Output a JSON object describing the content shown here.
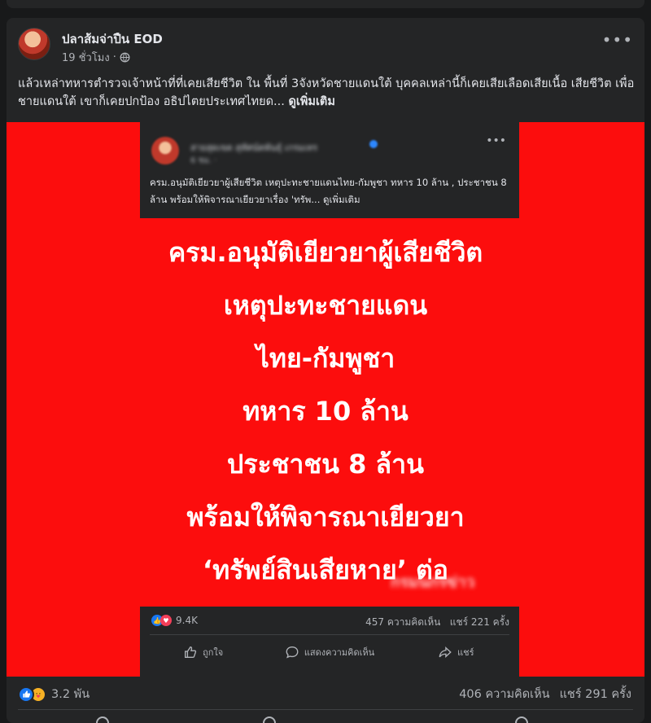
{
  "post": {
    "author": "ปลาส้มจ่าปืน EOD",
    "time": "19 ชั่วโมง",
    "separator": "·",
    "caption": "แล้วเหล่าทหารตำรวจเจ้าหน้าที่ที่เคยเสียชีวิต ใน พื้นที่ 3จังหวัดชายแดนใต้ บุคคลเหล่านี้ก็เคยเสียเลือดเสียเนื้อ เสียชีวิต เพื่อชายแดนใต้ เขาก็เคยปกป้อง อธิปไตยประเทศไทยด...",
    "see_more": "ดูเพิ่มเติม"
  },
  "inner_post": {
    "author": "สายสุดเขต สุทัศน์ตพันธุ์ เกรมเทร",
    "time": "6 ชม. ·",
    "caption": "ครม.อนุมัติเยียวยาผู้เสียชีวิต เหตุปะทะชายแดนไทย-กัมพูชา ทหาร 10 ล้าน , ประชาชน 8 ล้าน พร้อมให้พิจารณาเยียวยาเรื่อง 'ทรัพ...",
    "see_more": "ดูเพิ่มเติม",
    "reactions": "9.4K",
    "comments": "457 ความคิดเห็น",
    "shares": "แชร์ 221 ครั้ง",
    "like_label": "ถูกใจ",
    "comment_label": "แสดงความคิดเห็น",
    "share_label": "แชร์"
  },
  "headline": {
    "line1": "ครม.อนุมัติเยียวยาผู้เสียชีวิต",
    "line2": "เหตุปะทะชายแดน",
    "line3": "ไทย-กัมพูชา",
    "line4": "ทหาร 10 ล้าน",
    "line5": "ประชาชน 8 ล้าน",
    "line6": "พร้อมให้พิจารณาเยียวยา",
    "line7": "‘ทรัพย์สินเสียหาย’ ต่อ",
    "credit": "กรมนกรข่าว"
  },
  "stats": {
    "reactions": "3.2 พัน",
    "comments": "406 ความคิดเห็น",
    "shares": "แชร์ 291 ครั้ง"
  },
  "colors": {
    "background": "#18191a",
    "card": "#242526",
    "media_red": "#fc0d0d",
    "text_primary": "#e4e6eb",
    "text_secondary": "#b0b3b8",
    "like_blue": "#1877f2"
  },
  "icons": [
    "globe-icon",
    "more-icon",
    "like-icon",
    "care-icon",
    "love-icon",
    "comment-icon",
    "share-icon"
  ]
}
